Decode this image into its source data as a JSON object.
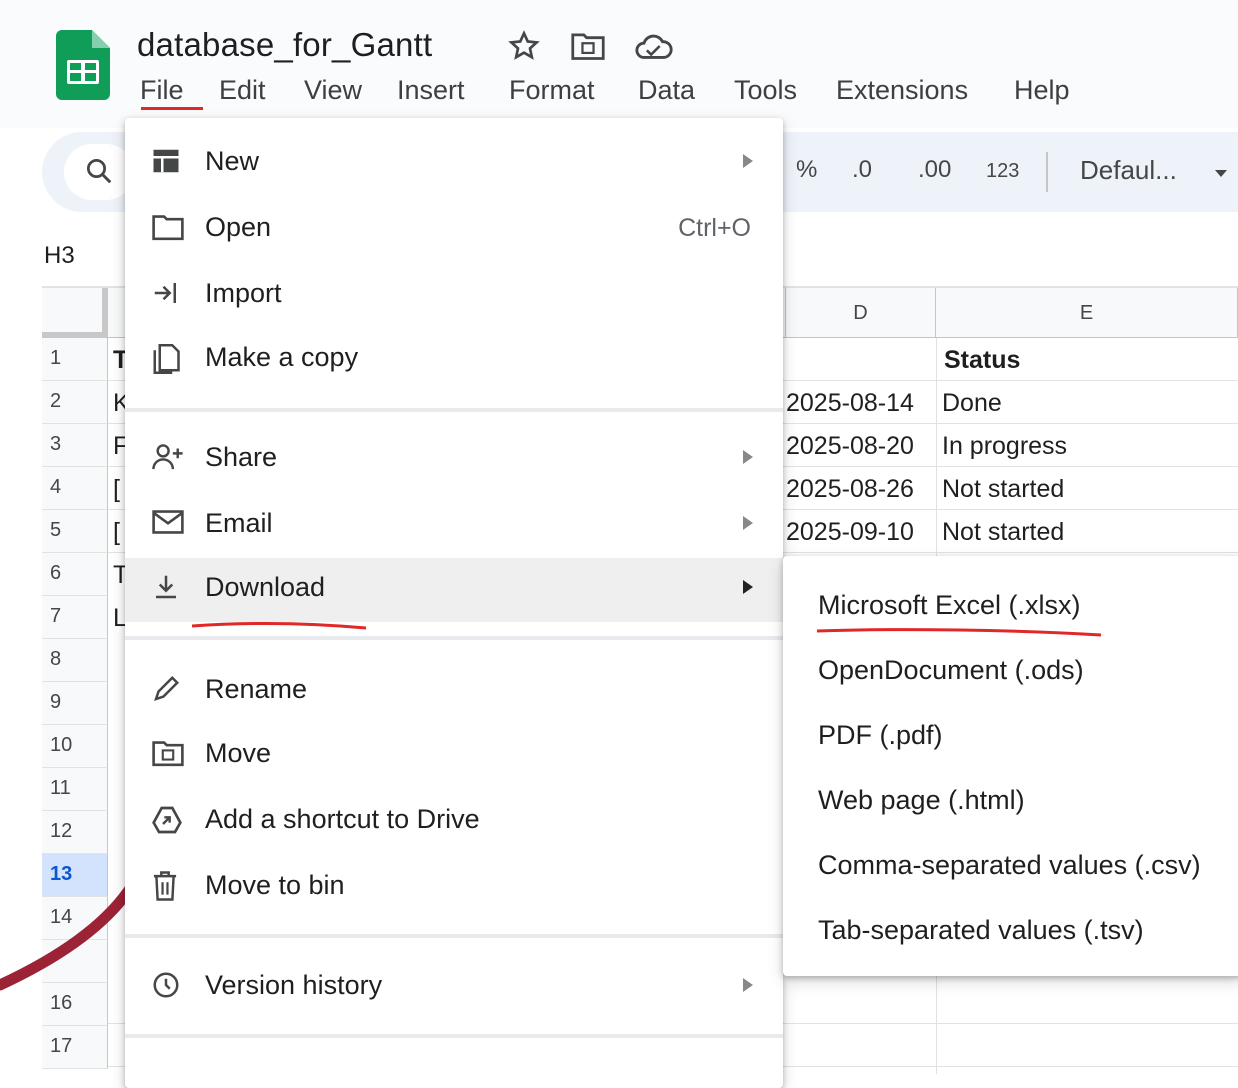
{
  "header": {
    "doc_title": "database_for_Gantt",
    "icons": [
      "star-icon",
      "move-folder-icon",
      "cloud-status-icon"
    ]
  },
  "menubar": {
    "items": [
      "File",
      "Edit",
      "View",
      "Insert",
      "Format",
      "Data",
      "Tools",
      "Extensions",
      "Help"
    ]
  },
  "toolbar": {
    "percent": "%",
    "decrease_decimal": ".0",
    "increase_decimal": ".00",
    "number_format": "123",
    "font": "Defaul...",
    "icons": [
      "search-icon",
      "dropdown-arrow-icon"
    ]
  },
  "name_box": "H3",
  "grid": {
    "column_headers": [
      "D",
      "E"
    ],
    "row_numbers": [
      "1",
      "2",
      "3",
      "4",
      "5",
      "6",
      "7",
      "8",
      "9",
      "10",
      "11",
      "12",
      "13",
      "14",
      "",
      "16",
      "17"
    ],
    "selected_row": "13",
    "col_b_visible_chars": [
      "T",
      "K",
      "F",
      "[",
      "[",
      "T",
      "L"
    ],
    "e1": "Status",
    "rows": [
      {
        "d": "2025-08-14",
        "e": "Done"
      },
      {
        "d": "2025-08-20",
        "e": "In progress"
      },
      {
        "d": "2025-08-26",
        "e": "Not started"
      },
      {
        "d": "2025-09-10",
        "e": "Not started"
      }
    ]
  },
  "file_menu": {
    "items": [
      {
        "label": "New",
        "icon": "new-sheet-icon",
        "submenu": true
      },
      {
        "label": "Open",
        "icon": "folder-open-icon",
        "shortcut": "Ctrl+O"
      },
      {
        "label": "Import",
        "icon": "import-icon"
      },
      {
        "label": "Make a copy",
        "icon": "copy-icon"
      },
      {
        "label": "Share",
        "icon": "share-person-icon",
        "submenu": true
      },
      {
        "label": "Email",
        "icon": "email-icon",
        "submenu": true
      },
      {
        "label": "Download",
        "icon": "download-icon",
        "submenu": true,
        "hovered": true
      },
      {
        "label": "Rename",
        "icon": "pencil-icon"
      },
      {
        "label": "Move",
        "icon": "move-folder-icon"
      },
      {
        "label": "Add a shortcut to Drive",
        "icon": "drive-shortcut-icon"
      },
      {
        "label": "Move to bin",
        "icon": "trash-icon"
      },
      {
        "label": "Version history",
        "icon": "history-icon",
        "submenu": true
      }
    ]
  },
  "download_submenu": {
    "items": [
      "Microsoft Excel (.xlsx)",
      "OpenDocument (.ods)",
      "PDF (.pdf)",
      "Web page (.html)",
      "Comma-separated values (.csv)",
      "Tab-separated values (.tsv)"
    ]
  },
  "colors": {
    "annotation_red": "#e02828",
    "arrow_dark_red": "#9b2335",
    "sheets_green": "#0f9d58",
    "hover_gray": "#efefef",
    "selected_row_blue": "#d3e3fd"
  }
}
